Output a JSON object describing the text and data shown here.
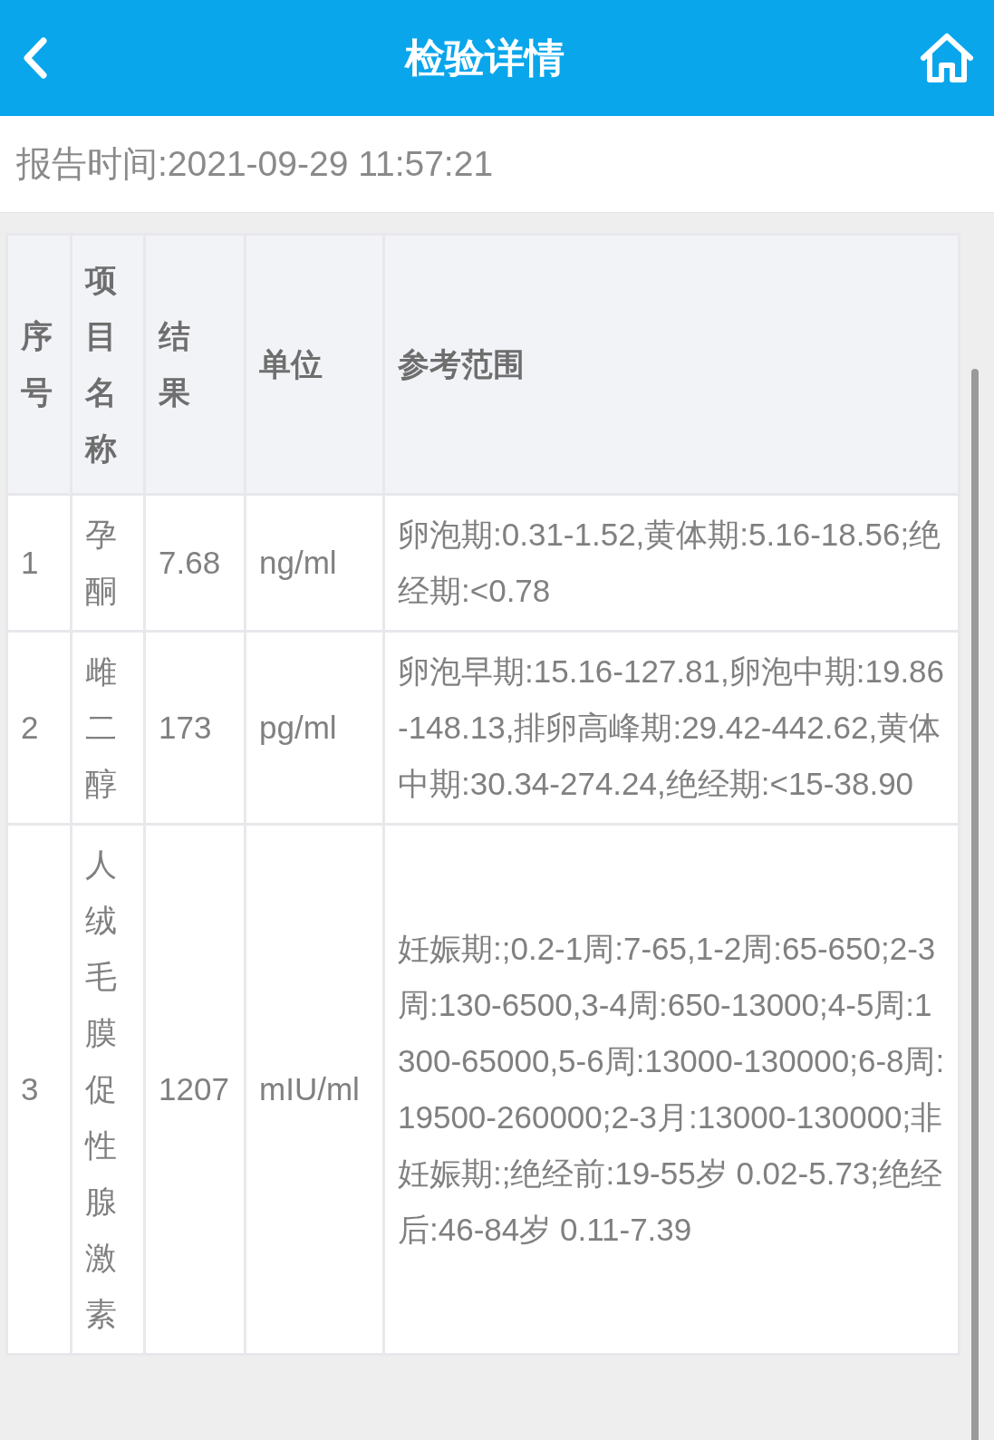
{
  "header": {
    "title": "检验详情"
  },
  "report_time": "报告时间:2021-09-29 11:57:21",
  "table": {
    "columns": [
      "序号",
      "项目名称",
      "结果",
      "单位",
      "参考范围"
    ],
    "rows": [
      [
        "1",
        "孕酮",
        "7.68",
        "ng/ml",
        "卵泡期:0.31-1.52,黄体期:5.16-18.56;绝经期:<0.78"
      ],
      [
        "2",
        "雌二醇",
        "173",
        "pg/ml",
        "卵泡早期:15.16-127.81,卵泡中期:19.86-148.13,排卵高峰期:29.42-442.62,黄体中期:30.34-274.24,绝经期:<15-38.90"
      ],
      [
        "3",
        "人绒毛膜促性腺激素",
        "1207",
        "mIU/ml",
        "妊娠期:;0.2-1周:7-65,1-2周:65-650;2-3周:130-6500,3-4周:650-13000;4-5周:1300-65000,5-6周:13000-130000;6-8周:19500-260000;2-3月:13000-130000;非妊娠期:;绝经前:19-55岁 0.02-5.73;绝经后:46-84岁 0.11-7.39"
      ]
    ]
  }
}
